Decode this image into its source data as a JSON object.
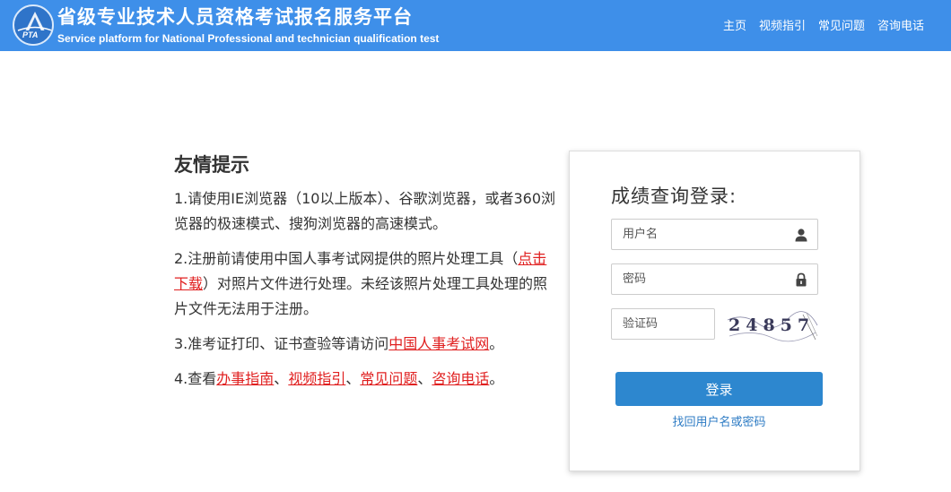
{
  "header": {
    "logo_text": "PTA",
    "title_cn": "省级专业技术人员资格考试报名服务平台",
    "title_en": "Service platform for National Professional and technician qualification test",
    "nav": [
      {
        "label": "主页"
      },
      {
        "label": "视频指引"
      },
      {
        "label": "常见问题"
      },
      {
        "label": "咨询电话"
      }
    ]
  },
  "tips": {
    "heading": "友情提示",
    "item1": "1.请使用IE浏览器（10以上版本）、谷歌浏览器，或者360浏览器的极速模式、搜狗浏览器的高速模式。",
    "item2_pre": "2.注册前请使用中国人事考试网提供的照片处理工具（",
    "item2_link": "点击下载",
    "item2_post": "）对照片文件进行处理。未经该照片处理工具处理的照片文件无法用于注册。",
    "item3_pre": "3.准考证打印、证书查验等请访问",
    "item3_link": "中国人事考试网",
    "item3_post": "。",
    "item4_pre": "4.查看",
    "item4_links": [
      "办事指南",
      "视频指引",
      "常见问题",
      "咨询电话"
    ],
    "item4_sep": "、",
    "item4_post": "。"
  },
  "login": {
    "title": "成绩查询登录:",
    "username_placeholder": "用户名",
    "password_placeholder": "密码",
    "captcha_placeholder": "验证码",
    "captcha_text": "24857",
    "submit_label": "登录",
    "forgot_label": "找回用户名或密码"
  },
  "icons": {
    "user": "user-icon",
    "lock": "lock-icon"
  },
  "colors": {
    "header_bg": "#3e8fe9",
    "link_red": "#e02020",
    "button_blue": "#2d87cf",
    "link_blue": "#2d7bc4"
  }
}
